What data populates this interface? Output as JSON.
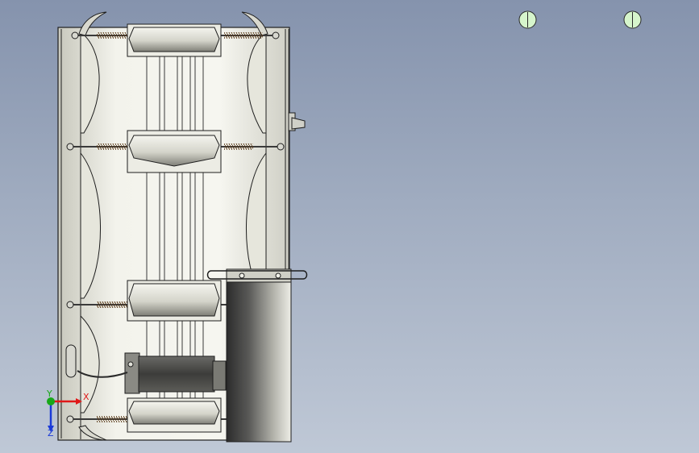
{
  "viewport": {
    "background_top": "#8593ad",
    "background_bottom": "#bfc8d6"
  },
  "model": {
    "body_color": "#f2f2ea",
    "shade_color": "#c9c9bf",
    "line_color": "#1e1e1e",
    "spring_color": "#5a3a18",
    "dark_panel_color": "#3b3b3b"
  },
  "triad": {
    "x_label": "X",
    "y_label": "Y",
    "z_label": "Z",
    "x_color": "#e01818",
    "y_color": "#18a818",
    "z_color": "#1a3ad8"
  },
  "markers": {
    "icon": "split-circle-icon",
    "fill": "#d6f5cc",
    "count": 2
  }
}
